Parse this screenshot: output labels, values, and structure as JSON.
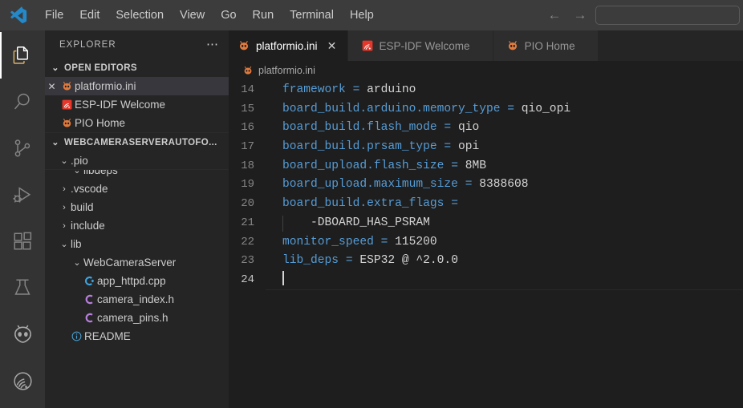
{
  "window": {
    "logo_icon": "vscode-logo",
    "menu": [
      "File",
      "Edit",
      "Selection",
      "View",
      "Go",
      "Run",
      "Terminal",
      "Help"
    ],
    "nav": {
      "back_icon": "arrow-left-icon",
      "forward_icon": "arrow-right-icon"
    },
    "command_center": {
      "value": "",
      "placeholder": ""
    }
  },
  "activity_bar": {
    "items": [
      {
        "name": "explorer",
        "icon": "files-icon",
        "active": true
      },
      {
        "name": "search",
        "icon": "search-icon",
        "active": false
      },
      {
        "name": "source-control",
        "icon": "source-control-icon",
        "active": false
      },
      {
        "name": "run-and-debug",
        "icon": "run-debug-icon",
        "active": false
      },
      {
        "name": "extensions",
        "icon": "extensions-icon",
        "active": false
      },
      {
        "name": "testing",
        "icon": "beaker-icon",
        "active": false
      },
      {
        "name": "platformio",
        "icon": "platformio-alien-icon",
        "active": false
      },
      {
        "name": "esp-idf",
        "icon": "espressif-icon",
        "active": false
      }
    ]
  },
  "sidebar": {
    "title": "EXPLORER",
    "more_actions_icon": "ellipsis-icon",
    "open_editors": {
      "label": "OPEN EDITORS",
      "chevron": "⌄",
      "items": [
        {
          "label": "platformio.ini",
          "icon": "platformio-file-icon",
          "selected": true,
          "has_close": true,
          "close_icon": "✕"
        },
        {
          "label": "ESP-IDF Welcome",
          "icon": "espressif-file-icon",
          "selected": false,
          "has_close": false
        },
        {
          "label": "PIO Home",
          "icon": "platformio-file-icon",
          "selected": false,
          "has_close": false
        }
      ]
    },
    "workspace": {
      "label": "WEBCAMERASERVERAUTOFO...",
      "chevron": "⌄",
      "tree": [
        {
          "label": ".pio",
          "icon": "folder-open",
          "twisty": "⌄",
          "depth": 1,
          "kind": "folder"
        },
        {
          "label": "libdeps",
          "icon": "folder-open",
          "twisty": "⌄",
          "depth": 2,
          "kind": "folder"
        },
        {
          "label": ".vscode",
          "icon": "folder",
          "twisty": "›",
          "depth": 1,
          "kind": "folder"
        },
        {
          "label": "build",
          "icon": "folder",
          "twisty": "›",
          "depth": 1,
          "kind": "folder"
        },
        {
          "label": "include",
          "icon": "folder",
          "twisty": "›",
          "depth": 1,
          "kind": "folder"
        },
        {
          "label": "lib",
          "icon": "folder-open",
          "twisty": "⌄",
          "depth": 1,
          "kind": "folder"
        },
        {
          "label": "WebCameraServer",
          "icon": "folder-open",
          "twisty": "⌄",
          "depth": 2,
          "kind": "folder"
        },
        {
          "label": "app_httpd.cpp",
          "icon": "cpp-file-icon",
          "twisty": "",
          "depth": 3,
          "kind": "file"
        },
        {
          "label": "camera_index.h",
          "icon": "header-file-icon",
          "twisty": "",
          "depth": 3,
          "kind": "file"
        },
        {
          "label": "camera_pins.h",
          "icon": "header-file-icon",
          "twisty": "",
          "depth": 3,
          "kind": "file"
        },
        {
          "label": "README",
          "icon": "info-file-icon",
          "twisty": "",
          "depth": 2,
          "kind": "file"
        }
      ]
    }
  },
  "editor": {
    "tabs": [
      {
        "label": "platformio.ini",
        "icon": "platformio-file-icon",
        "active": true,
        "close_icon": "✕"
      },
      {
        "label": "ESP-IDF Welcome",
        "icon": "espressif-file-icon",
        "active": false
      },
      {
        "label": "PIO Home",
        "icon": "platformio-file-icon",
        "active": false
      }
    ],
    "breadcrumb": {
      "label": "platformio.ini",
      "icon": "platformio-file-icon"
    },
    "lines": [
      {
        "n": "14",
        "key": "framework",
        "op": " = ",
        "value": "arduino",
        "indent_guide": false,
        "current": false
      },
      {
        "n": "15",
        "key": "board_build.arduino.memory_type",
        "op": " = ",
        "value": "qio_opi",
        "indent_guide": false,
        "current": false
      },
      {
        "n": "16",
        "key": "board_build.flash_mode",
        "op": " = ",
        "value": "qio",
        "indent_guide": false,
        "current": false
      },
      {
        "n": "17",
        "key": "board_build.prsam_type",
        "op": " = ",
        "value": "opi",
        "indent_guide": false,
        "current": false
      },
      {
        "n": "18",
        "key": "board_upload.flash_size",
        "op": " = ",
        "value": "8MB",
        "indent_guide": false,
        "current": false
      },
      {
        "n": "19",
        "key": "board_upload.maximum_size",
        "op": " = ",
        "value": "8388608",
        "indent_guide": false,
        "current": false
      },
      {
        "n": "20",
        "key": "board_build.extra_flags",
        "op": " =",
        "value": "",
        "indent_guide": false,
        "current": false
      },
      {
        "n": "21",
        "key": "",
        "op": "",
        "value": "    -DBOARD_HAS_PSRAM",
        "indent_guide": true,
        "current": false
      },
      {
        "n": "22",
        "key": "monitor_speed",
        "op": " = ",
        "value": "115200",
        "indent_guide": false,
        "current": false
      },
      {
        "n": "23",
        "key": "lib_deps",
        "op": " = ",
        "value": "ESP32 @ ^2.0.0",
        "indent_guide": false,
        "current": false
      },
      {
        "n": "24",
        "key": "",
        "op": "",
        "value": "",
        "indent_guide": false,
        "current": true,
        "cursor": true
      }
    ]
  },
  "colors": {
    "editor_bg": "#1e1e1e",
    "sidebar_bg": "#252526",
    "activity_bg": "#333333",
    "titlebar_bg": "#3c3c3c",
    "key_blue": "#569cd6",
    "value_text": "#d4d4d4",
    "line_number": "#858585",
    "selected_row": "#37373d",
    "platformio_orange": "#e07a3e",
    "espressif_red": "#e8362a"
  }
}
